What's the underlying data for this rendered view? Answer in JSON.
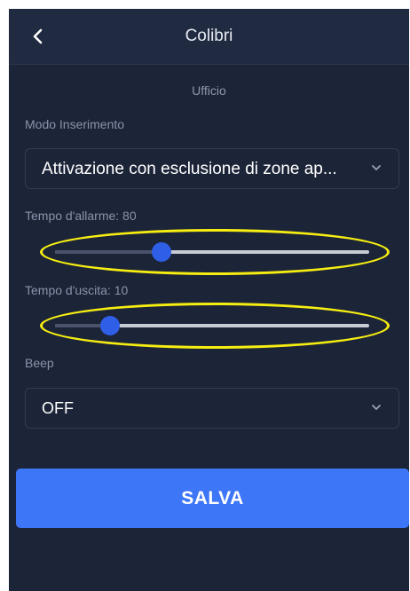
{
  "header": {
    "title": "Colibri",
    "back_icon": "chevron-left-icon"
  },
  "subtitle": "Ufficio",
  "mode": {
    "label": "Modo Inserimento",
    "selected": "Attivazione con esclusione di zone ap...",
    "icon": "chevron-down-icon"
  },
  "alarm_time": {
    "label": "Tempo d'allarme: 80",
    "value_fraction": 0.34
  },
  "exit_time": {
    "label": "Tempo d'uscita: 10",
    "value_fraction": 0.175
  },
  "beep": {
    "label": "Beep",
    "selected": "OFF",
    "icon": "chevron-down-icon"
  },
  "save_label": "SALVA",
  "colors": {
    "background": "#1c2438",
    "header": "#202a40",
    "accent": "#3d76f7",
    "thumb": "#2f5fe6",
    "highlight": "#f6ee11"
  }
}
